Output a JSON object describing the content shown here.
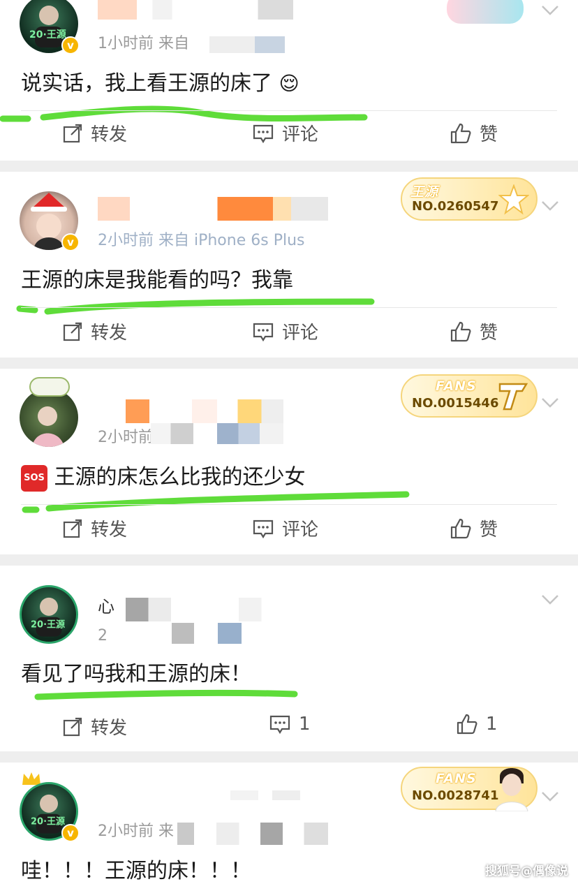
{
  "posts": [
    {
      "meta": "1小时前  来自",
      "content": "说实话，我上看王源的床了",
      "emoji": "😌",
      "actions": {
        "repost": "转发",
        "comment": "评论",
        "like": "赞"
      }
    },
    {
      "name": "...",
      "meta": "2小时前  来自 iPhone 6s Plus",
      "content": "王源的床是我能看的吗？我靠",
      "badge": {
        "label": "王源",
        "number": "NO.0260547"
      },
      "actions": {
        "repost": "转发",
        "comment": "评论",
        "like": "赞"
      }
    },
    {
      "meta": "2小时前",
      "content": "王源的床怎么比我的还少女",
      "sos": "SOS",
      "badge": {
        "label": "FANS",
        "number": "NO.0015446"
      },
      "actions": {
        "repost": "转发",
        "comment": "评论",
        "like": "赞"
      }
    },
    {
      "name": "心",
      "meta": "2",
      "content": "看见了吗我和王源的床！",
      "actions": {
        "repost": "转发",
        "comment": "1",
        "like": "1"
      }
    },
    {
      "meta": "2小时前  来",
      "content": "哇！！！王源的床！！！",
      "badge": {
        "label": "FANS",
        "number": "NO.0028741"
      }
    }
  ],
  "watermark": "搜狐号@偶像说",
  "colors": {
    "accent_green": "#5fdc3a",
    "meta_gray": "#9a9a9a",
    "vip_gold": "#f7b500"
  }
}
